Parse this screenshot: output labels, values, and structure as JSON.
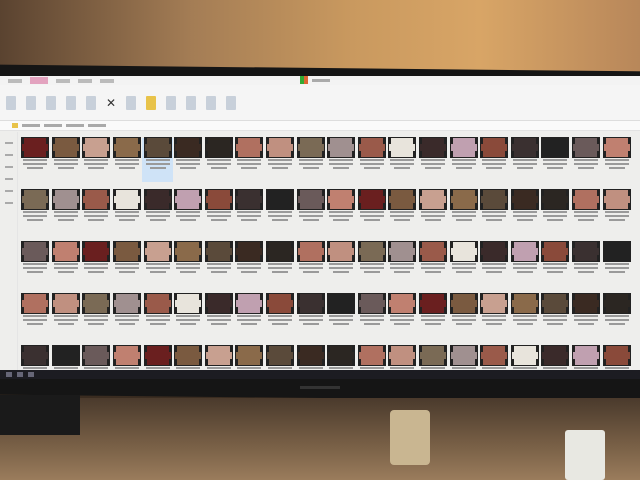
{
  "scene": {
    "wall_color": "#b8875a",
    "desk_color": "#7a6147"
  },
  "explorer": {
    "ribbon_tabs": 5,
    "active_tab_color": "#e3a3bf",
    "selected_item_index": 4,
    "thumbnail_tints": [
      "#6a1f1f",
      "#8a6a4a",
      "#2b2622",
      "#7a6a55",
      "#e8e4dc",
      "#8a4a3a",
      "#6a5a5a",
      "#7a5a40",
      "#5a4a3a",
      "#b07060",
      "#a09090",
      "#3a2a2a",
      "#3a3030",
      "#c08070",
      "#c8a090",
      "#3a2a22",
      "#c09080",
      "#9a5a4a",
      "#c0a0b0",
      "#222222"
    ]
  }
}
